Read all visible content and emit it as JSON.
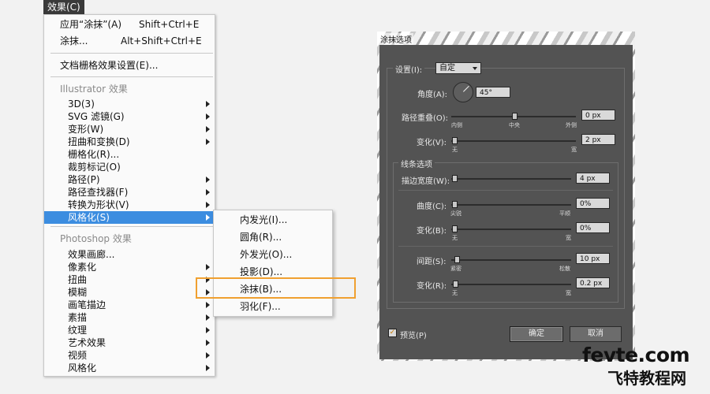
{
  "menu": {
    "title": "效果(C)",
    "items_top": [
      {
        "label": "应用“涂抹”(A)",
        "shortcut": "Shift+Ctrl+E"
      },
      {
        "label": "涂抹...",
        "shortcut": "Alt+Shift+Ctrl+E"
      },
      {
        "label": "文档栅格效果设置(E)..."
      }
    ],
    "illustrator_group": "Illustrator 效果",
    "illustrator_items": [
      "3D(3)",
      "SVG 滤镜(G)",
      "变形(W)",
      "扭曲和变换(D)",
      "栅格化(R)...",
      "裁剪标记(O)",
      "路径(P)",
      "路径查找器(F)",
      "转换为形状(V)",
      "风格化(S)"
    ],
    "photoshop_group": "Photoshop 效果",
    "photoshop_items": [
      "效果画廊...",
      "像素化",
      "扭曲",
      "模糊",
      "画笔描边",
      "素描",
      "纹理",
      "艺术效果",
      "视频",
      "风格化"
    ]
  },
  "submenu": {
    "items": [
      "内发光(I)...",
      "圆角(R)...",
      "外发光(O)...",
      "投影(D)...",
      "涂抹(B)...",
      "羽化(F)..."
    ]
  },
  "dialog": {
    "title": "涂抹选项",
    "settings_label": "设置(I):",
    "settings_value": "自定",
    "angle_label": "角度(A):",
    "angle_value": "45°",
    "path_overlap_label": "路径重叠(O):",
    "path_overlap_value": "0 px",
    "overlap_ticks": [
      "内侧",
      "中央",
      "外侧"
    ],
    "variation1_label": "变化(V):",
    "variation1_value": "2 px",
    "var_ticks": [
      "无",
      "宽"
    ],
    "line_options_label": "线条选项",
    "stroke_width_label": "描边宽度(W):",
    "stroke_width_value": "4 px",
    "curviness_label": "曲度(C):",
    "curviness_value": "0%",
    "curviness_ticks": [
      "尖锐",
      "平顺"
    ],
    "variation2_label": "变化(B):",
    "variation2_value": "0%",
    "spacing_label": "间距(S):",
    "spacing_value": "10 px",
    "spacing_ticks": [
      "紧密",
      "松散"
    ],
    "variation3_label": "变化(R):",
    "variation3_value": "0.2 px",
    "preview_label": "预览(P)",
    "preview_checked": true,
    "ok_label": "确定",
    "cancel_label": "取消"
  },
  "watermark": {
    "line1": "fevte.com",
    "line2": "飞特教程网"
  },
  "colors": {
    "highlight": "#3c8de0",
    "callout": "#f0a030",
    "dialog_bg": "#535353"
  }
}
